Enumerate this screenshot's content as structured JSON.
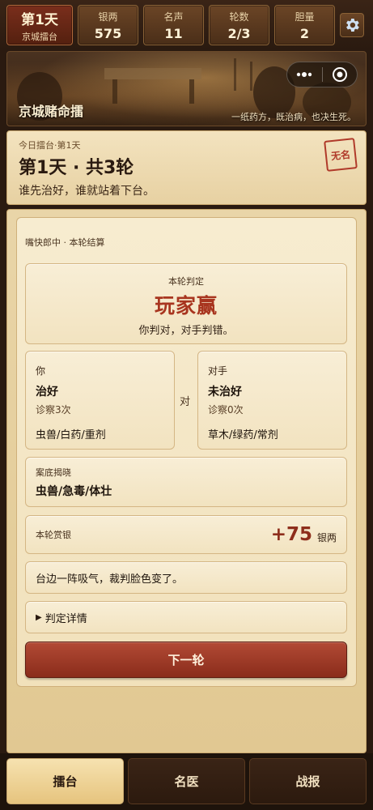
{
  "stats": {
    "day": {
      "title": "第1天",
      "subtitle": "京城擂台"
    },
    "items": [
      {
        "label": "银两",
        "value": "575"
      },
      {
        "label": "名声",
        "value": "11"
      },
      {
        "label": "轮数",
        "value": "2/3"
      },
      {
        "label": "胆量",
        "value": "2"
      }
    ],
    "settings_icon": "gear-icon"
  },
  "banner": {
    "title": "京城赌命擂",
    "slogan": "一纸药方，既治病，也决生死。",
    "capsule_icons": [
      "more-dots-icon",
      "close-circle-icon"
    ]
  },
  "arena": {
    "subtitle": "今日擂台·第1天",
    "heading": "第1天 · 共3轮",
    "description": "谁先治好，谁就站着下台。",
    "seal": "无名"
  },
  "result": {
    "section_label": "嘴快郎中 · 本轮结算",
    "verdict": {
      "label": "本轮判定",
      "result": "玩家赢",
      "description": "你判对，对手判错。"
    },
    "you": {
      "who": "你",
      "outcome": "治好",
      "count": "诊察3次",
      "diagnosis": "虫兽/白药/重剂"
    },
    "vs": "对",
    "opponent": {
      "who": "对手",
      "outcome": "未治好",
      "count": "诊察0次",
      "diagnosis": "草木/绿药/常剂"
    },
    "reveal": {
      "label": "案底揭晓",
      "value": "虫兽/急毒/体壮"
    },
    "reward": {
      "label": "本轮赏银",
      "amount": "+75",
      "unit": "银两"
    },
    "flavor": "台边一阵吸气，裁判脸色变了。",
    "details": "判定详情",
    "next_button": "下一轮"
  },
  "tabs": [
    {
      "label": "擂台",
      "active": true
    },
    {
      "label": "名医",
      "active": false
    },
    {
      "label": "战报",
      "active": false
    }
  ],
  "colors": {
    "accent_red": "#a8351f",
    "parchment": "#f3e3bf",
    "dark_bg": "#2a1a10"
  }
}
